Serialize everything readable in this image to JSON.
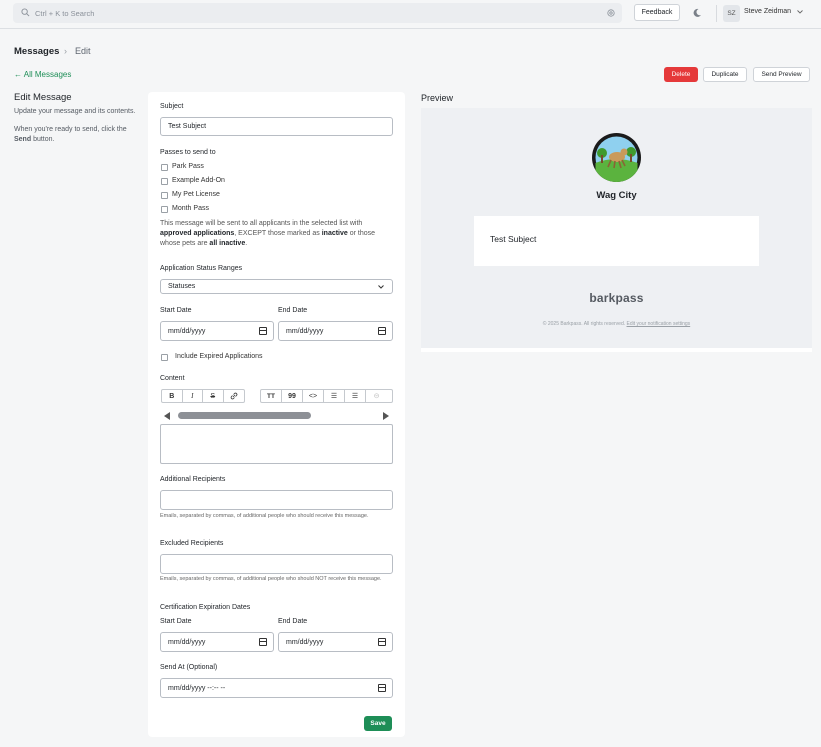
{
  "topbar": {
    "search_placeholder": "Ctrl + K to Search",
    "feedback_label": "Feedback",
    "user_initials": "SZ",
    "user_name": "Steve Zeidman"
  },
  "breadcrumb": {
    "root": "Messages",
    "separator": "›",
    "current": "Edit"
  },
  "back_link": "← All Messages",
  "actions": {
    "delete": "Delete",
    "duplicate": "Duplicate",
    "send_preview": "Send Preview"
  },
  "intro": {
    "title": "Edit Message",
    "line1": "Update your message and its contents.",
    "line2_prefix": "When you're ready to send, click the ",
    "line2_bold": "Send",
    "line2_suffix": " button."
  },
  "form": {
    "subject_label": "Subject",
    "subject_value": "Test Subject",
    "passes_label": "Passes to send to",
    "passes": [
      "Park Pass",
      "Example Add-On",
      "My Pet License",
      "Month Pass"
    ],
    "note": {
      "p1": "This message will be sent to all applicants in the selected list with ",
      "b1": "approved applications",
      "p2": ", EXCEPT those marked as ",
      "b2": "inactive",
      "p3": " or those whose pets are ",
      "b3": "all inactive",
      "p4": "."
    },
    "status_label": "Application Status Ranges",
    "status_value": "Statuses",
    "start_date_label": "Start Date",
    "end_date_label": "End Date",
    "date_placeholder": "mm/dd/yyyy",
    "include_expired_label": "Include Expired Applications",
    "content_label": "Content",
    "toolbar": {
      "bold": "B",
      "italic": "I",
      "strike": "S",
      "link": "🔗",
      "heading": "TT",
      "quote": "99",
      "code": "<>",
      "ul": "☰",
      "ol": "☰",
      "more": "⊝"
    },
    "additional_label": "Additional Recipients",
    "additional_help": "Emails, separated by commas, of additional people who should receive this message.",
    "excluded_label": "Excluded Recipients",
    "excluded_help": "Emails, separated by commas, of additional people who should NOT receive this message.",
    "cert_label": "Certification Expiration Dates",
    "cert_start_label": "Start Date",
    "cert_end_label": "End Date",
    "send_at_label": "Send At (Optional)",
    "send_at_placeholder": "mm/dd/yyyy --:-- --",
    "save_label": "Save"
  },
  "preview": {
    "title": "Preview",
    "org_name": "Wag City",
    "subject": "Test Subject",
    "brand": "barkpass",
    "footer_prefix": "© 2025 Barkpass. All rights reserved. ",
    "footer_link": "Edit your notification settings"
  },
  "colors": {
    "accent": "#1e8e57",
    "danger": "#e5393a"
  }
}
